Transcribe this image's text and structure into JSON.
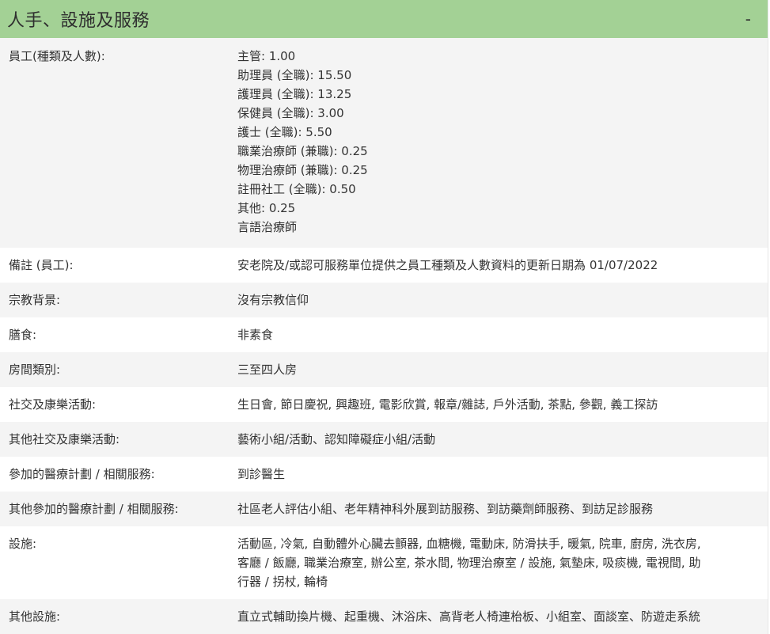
{
  "section": {
    "title": "人手、設施及服務",
    "collapse_symbol": "-"
  },
  "rows": {
    "staff": {
      "label": "員工(種類及人數):",
      "lines": [
        "主管: 1.00",
        "助理員 (全職): 15.50",
        "護理員 (全職): 13.25",
        "保健員 (全職): 3.00",
        "護士 (全職): 5.50",
        "職業治療師 (兼職): 0.25",
        "物理治療師 (兼職): 0.25",
        "註冊社工 (全職): 0.50",
        "其他: 0.25",
        "言語治療師"
      ]
    },
    "staff_remark": {
      "label": "備註 (員工):",
      "value": "安老院及/或認可服務單位提供之員工種類及人數資料的更新日期為 01/07/2022"
    },
    "religion": {
      "label": "宗教背景:",
      "value": "沒有宗教信仰"
    },
    "meals": {
      "label": "膳食:",
      "value": "非素食"
    },
    "room_type": {
      "label": "房間類別:",
      "value": "三至四人房"
    },
    "social_activities": {
      "label": "社交及康樂活動:",
      "value": "生日會, 節日慶祝, 興趣班, 電影欣賞, 報章/雜誌, 戶外活動, 茶點, 參觀, 義工探訪"
    },
    "other_social_activities": {
      "label": "其他社交及康樂活動:",
      "value": "藝術小組/活動、認知障礙症小組/活動"
    },
    "medical_programs": {
      "label": "參加的醫療計劃 / 相關服務:",
      "value": "到診醫生"
    },
    "other_medical_programs": {
      "label": "其他參加的醫療計劃 / 相關服務:",
      "value": "社區老人評估小組、老年精神科外展到訪服務、到訪藥劑師服務、到訪足診服務"
    },
    "facilities": {
      "label": "設施:",
      "lines": [
        "活動區, 冷氣, 自動體外心臟去顫器, 血糖機, 電動床, 防滑扶手, 暖氣, 院車, 廚房, 洗衣房,",
        "客廳 / 飯廳, 職業治療室, 辦公室, 茶水間, 物理治療室 / 設施, 氣墊床, 吸痰機, 電視間, 助",
        "行器 / 拐杖, 輪椅"
      ]
    },
    "other_facilities": {
      "label": "其他設施:",
      "value": "直立式輔助換片機、起重機、沐浴床、高背老人椅連枱板、小組室、面談室、防遊走系統"
    }
  }
}
